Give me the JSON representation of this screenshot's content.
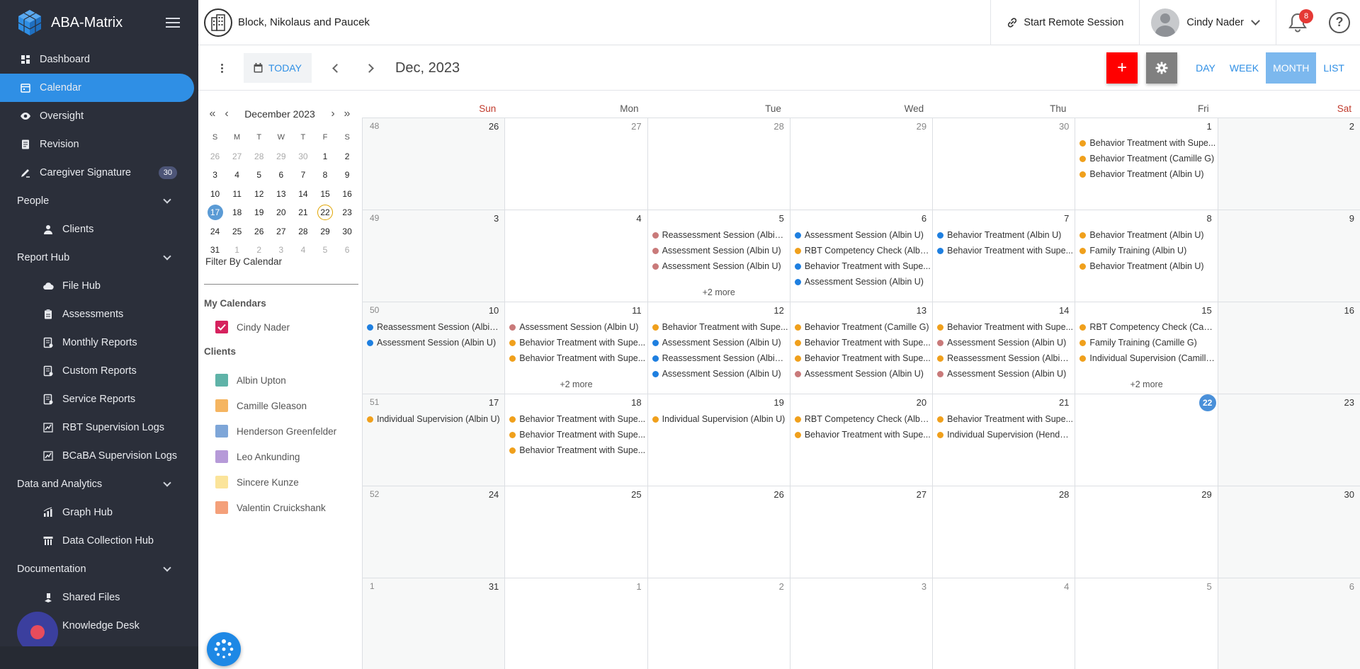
{
  "app": {
    "name": "ABA-Matrix"
  },
  "colors": {
    "sidebar_bg": "#2b2f3a",
    "accent": "#2f8fe5",
    "add_button": "#ff0000",
    "settings_button": "#808080",
    "event_orange": "#f0a01c",
    "event_blue": "#1e7fe0",
    "event_rose": "#c97a7a"
  },
  "sidebar": {
    "items": [
      {
        "key": "dashboard",
        "label": "Dashboard",
        "icon": "dashboard-icon"
      },
      {
        "key": "calendar",
        "label": "Calendar",
        "icon": "calendar-icon",
        "active": true
      },
      {
        "key": "oversight",
        "label": "Oversight",
        "icon": "eye-icon"
      },
      {
        "key": "revision",
        "label": "Revision",
        "icon": "document-icon"
      },
      {
        "key": "caregiver",
        "label": "Caregiver Signature",
        "icon": "signature-icon",
        "badge": "30"
      }
    ],
    "groups": [
      {
        "label": "People",
        "items": [
          {
            "label": "Clients",
            "icon": "person-icon"
          }
        ]
      },
      {
        "label": "Report Hub",
        "items": [
          {
            "label": "File Hub",
            "icon": "cloud-icon"
          },
          {
            "label": "Assessments",
            "icon": "clipboard-icon"
          },
          {
            "label": "Monthly Reports",
            "icon": "report-icon"
          },
          {
            "label": "Custom Reports",
            "icon": "report-icon"
          },
          {
            "label": "Service Reports",
            "icon": "report-icon"
          },
          {
            "label": "RBT Supervision Logs",
            "icon": "chart-icon"
          },
          {
            "label": "BCaBA Supervision Logs",
            "icon": "chart-icon"
          }
        ]
      },
      {
        "label": "Data and Analytics",
        "items": [
          {
            "label": "Graph Hub",
            "icon": "graph-icon"
          },
          {
            "label": "Data Collection Hub",
            "icon": "data-icon"
          }
        ]
      },
      {
        "label": "Documentation",
        "items": [
          {
            "label": "Shared Files",
            "icon": "shared-files-icon"
          },
          {
            "label": "Knowledge Desk",
            "icon": "book-icon"
          }
        ]
      }
    ]
  },
  "header": {
    "org_name": "Block, Nikolaus and Paucek",
    "remote_session": "Start Remote Session",
    "user_name": "Cindy Nader",
    "notifications_count": "8",
    "help_glyph": "?"
  },
  "toolbar": {
    "today": "TODAY",
    "month_title": "Dec, 2023",
    "add_glyph": "+",
    "views": [
      {
        "label": "DAY"
      },
      {
        "label": "WEEK"
      },
      {
        "label": "MONTH",
        "active": true
      },
      {
        "label": "LIST"
      }
    ]
  },
  "mini_calendar": {
    "title": "December 2023",
    "arrows": {
      "prev_year": "«",
      "prev": "‹",
      "next": "›",
      "next_year": "»"
    },
    "dow": [
      "S",
      "M",
      "T",
      "W",
      "T",
      "F",
      "S"
    ],
    "weeks": [
      [
        {
          "d": "26",
          "m": true
        },
        {
          "d": "27",
          "m": true
        },
        {
          "d": "28",
          "m": true
        },
        {
          "d": "29",
          "m": true
        },
        {
          "d": "30",
          "m": true
        },
        {
          "d": "1"
        },
        {
          "d": "2"
        }
      ],
      [
        {
          "d": "3"
        },
        {
          "d": "4"
        },
        {
          "d": "5"
        },
        {
          "d": "6"
        },
        {
          "d": "7"
        },
        {
          "d": "8"
        },
        {
          "d": "9"
        }
      ],
      [
        {
          "d": "10"
        },
        {
          "d": "11"
        },
        {
          "d": "12"
        },
        {
          "d": "13"
        },
        {
          "d": "14"
        },
        {
          "d": "15"
        },
        {
          "d": "16"
        }
      ],
      [
        {
          "d": "17",
          "sel": true
        },
        {
          "d": "18"
        },
        {
          "d": "19"
        },
        {
          "d": "20"
        },
        {
          "d": "21"
        },
        {
          "d": "22",
          "cur": true
        },
        {
          "d": "23"
        }
      ],
      [
        {
          "d": "24"
        },
        {
          "d": "25"
        },
        {
          "d": "26"
        },
        {
          "d": "27"
        },
        {
          "d": "28"
        },
        {
          "d": "29"
        },
        {
          "d": "30"
        }
      ],
      [
        {
          "d": "31"
        },
        {
          "d": "1",
          "m": true
        },
        {
          "d": "2",
          "m": true
        },
        {
          "d": "3",
          "m": true
        },
        {
          "d": "4",
          "m": true
        },
        {
          "d": "5",
          "m": true
        },
        {
          "d": "6",
          "m": true
        }
      ]
    ],
    "filter_label": "Filter By Calendar"
  },
  "calendars": {
    "my_title": "My Calendars",
    "my": [
      {
        "label": "Cindy Nader",
        "color": "#d6225e"
      }
    ],
    "clients_title": "Clients",
    "clients": [
      {
        "label": "Albin Upton",
        "color": "#5fb3a8"
      },
      {
        "label": "Camille Gleason",
        "color": "#f5b561"
      },
      {
        "label": "Henderson Greenfelder",
        "color": "#7ea6d8"
      },
      {
        "label": "Leo Ankunding",
        "color": "#b69ad8"
      },
      {
        "label": "Sincere Kunze",
        "color": "#fbe49a"
      },
      {
        "label": "Valentin Cruickshank",
        "color": "#f4a07a"
      }
    ]
  },
  "month_grid": {
    "dow": [
      "Sun",
      "Mon",
      "Tue",
      "Wed",
      "Thu",
      "Fri",
      "Sat"
    ],
    "weeks": [
      {
        "wk": "48",
        "days": [
          {
            "d": "26"
          },
          {
            "d": "27",
            "m": true
          },
          {
            "d": "28",
            "m": true
          },
          {
            "d": "29",
            "m": true
          },
          {
            "d": "30",
            "m": true
          },
          {
            "d": "1",
            "events": [
              {
                "t": "Behavior Treatment with Supe...",
                "c": "o"
              },
              {
                "t": "Behavior Treatment (Camille G)",
                "c": "o"
              },
              {
                "t": "Behavior Treatment (Albin U)",
                "c": "o"
              }
            ]
          },
          {
            "d": "2"
          }
        ]
      },
      {
        "wk": "49",
        "days": [
          {
            "d": "3"
          },
          {
            "d": "4"
          },
          {
            "d": "5",
            "events": [
              {
                "t": "Reassessment Session (Albin U)",
                "c": "r"
              },
              {
                "t": "Assessment Session (Albin U)",
                "c": "r"
              },
              {
                "t": "Assessment Session (Albin U)",
                "c": "r"
              }
            ],
            "more": "+2 more"
          },
          {
            "d": "6",
            "events": [
              {
                "t": "Assessment Session (Albin U)",
                "c": "b"
              },
              {
                "t": "RBT Competency Check (Albin U)",
                "c": "o"
              },
              {
                "t": "Behavior Treatment with Supe...",
                "c": "b"
              },
              {
                "t": "Assessment Session (Albin U)",
                "c": "b"
              }
            ]
          },
          {
            "d": "7",
            "events": [
              {
                "t": "Behavior Treatment (Albin U)",
                "c": "b"
              },
              {
                "t": "Behavior Treatment with Supe...",
                "c": "b"
              }
            ]
          },
          {
            "d": "8",
            "events": [
              {
                "t": "Behavior Treatment (Albin U)",
                "c": "o"
              },
              {
                "t": "Family Training (Albin U)",
                "c": "o"
              },
              {
                "t": "Behavior Treatment (Albin U)",
                "c": "o"
              }
            ]
          },
          {
            "d": "9"
          }
        ]
      },
      {
        "wk": "50",
        "days": [
          {
            "d": "10",
            "events": [
              {
                "t": "Reassessment Session (Albin U)",
                "c": "b"
              },
              {
                "t": "Assessment Session (Albin U)",
                "c": "b"
              }
            ]
          },
          {
            "d": "11",
            "events": [
              {
                "t": "Assessment Session (Albin U)",
                "c": "r"
              },
              {
                "t": "Behavior Treatment with Supe...",
                "c": "o"
              },
              {
                "t": "Behavior Treatment with Supe...",
                "c": "o"
              }
            ],
            "more": "+2 more"
          },
          {
            "d": "12",
            "events": [
              {
                "t": "Behavior Treatment with Supe...",
                "c": "o"
              },
              {
                "t": "Assessment Session (Albin U)",
                "c": "b"
              },
              {
                "t": "Reassessment Session (Albin U)",
                "c": "b"
              },
              {
                "t": "Assessment Session (Albin U)",
                "c": "b"
              }
            ]
          },
          {
            "d": "13",
            "events": [
              {
                "t": "Behavior Treatment (Camille G)",
                "c": "o"
              },
              {
                "t": "Behavior Treatment with Supe...",
                "c": "o"
              },
              {
                "t": "Behavior Treatment with Supe...",
                "c": "o"
              },
              {
                "t": "Assessment Session (Albin U)",
                "c": "r"
              }
            ]
          },
          {
            "d": "14",
            "events": [
              {
                "t": "Behavior Treatment with Supe...",
                "c": "o"
              },
              {
                "t": "Assessment Session (Albin U)",
                "c": "r"
              },
              {
                "t": "Reassessment Session (Albin U)",
                "c": "o"
              },
              {
                "t": "Assessment Session (Albin U)",
                "c": "r"
              }
            ]
          },
          {
            "d": "15",
            "events": [
              {
                "t": "RBT Competency Check (Camille G)",
                "c": "o"
              },
              {
                "t": "Family Training (Camille G)",
                "c": "o"
              },
              {
                "t": "Individual Supervision (Camille G)",
                "c": "o"
              }
            ],
            "more": "+2 more"
          },
          {
            "d": "16"
          }
        ]
      },
      {
        "wk": "51",
        "days": [
          {
            "d": "17",
            "events": [
              {
                "t": "Individual Supervision (Albin U)",
                "c": "o"
              }
            ]
          },
          {
            "d": "18",
            "events": [
              {
                "t": "Behavior Treatment with Supe...",
                "c": "o"
              },
              {
                "t": "Behavior Treatment with Supe...",
                "c": "o"
              },
              {
                "t": "Behavior Treatment with Supe...",
                "c": "o"
              }
            ]
          },
          {
            "d": "19",
            "events": [
              {
                "t": "Individual Supervision (Albin U)",
                "c": "o"
              }
            ]
          },
          {
            "d": "20",
            "events": [
              {
                "t": "RBT Competency Check (Albin U)",
                "c": "o"
              },
              {
                "t": "Behavior Treatment with Supe...",
                "c": "o"
              }
            ]
          },
          {
            "d": "21",
            "events": [
              {
                "t": "Behavior Treatment with Supe...",
                "c": "o"
              },
              {
                "t": "Individual Supervision (Henderson G)",
                "c": "o"
              }
            ]
          },
          {
            "d": "22",
            "today": true
          },
          {
            "d": "23"
          }
        ]
      },
      {
        "wk": "52",
        "days": [
          {
            "d": "24"
          },
          {
            "d": "25"
          },
          {
            "d": "26"
          },
          {
            "d": "27"
          },
          {
            "d": "28"
          },
          {
            "d": "29"
          },
          {
            "d": "30"
          }
        ]
      },
      {
        "wk": "1",
        "days": [
          {
            "d": "31"
          },
          {
            "d": "1",
            "m": true
          },
          {
            "d": "2",
            "m": true
          },
          {
            "d": "3",
            "m": true
          },
          {
            "d": "4",
            "m": true
          },
          {
            "d": "5",
            "m": true
          },
          {
            "d": "6",
            "m": true
          }
        ]
      }
    ]
  }
}
